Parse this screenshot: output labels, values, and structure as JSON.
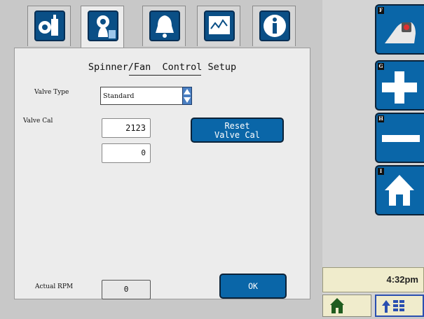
{
  "tabs": [
    {
      "name": "machine-settings-icon"
    },
    {
      "name": "spinner-fan-settings-icon"
    },
    {
      "name": "alarm-bell-icon"
    },
    {
      "name": "performance-monitor-icon"
    },
    {
      "name": "info-icon"
    }
  ],
  "page": {
    "title": "Spinner/Fan  Control Setup",
    "valve_type_label": "Valve Type",
    "valve_type_value": "Standard",
    "valve_cal_label": "Valve Cal",
    "valve_cal_value": "2123",
    "valve_cal_secondary": "0",
    "reset_label": "Reset\nValve Cal",
    "actual_rpm_label": "Actual RPM",
    "actual_rpm_value": "0",
    "ok_label": "OK"
  },
  "side_buttons": [
    {
      "key": "F",
      "icon": "camera-icon"
    },
    {
      "key": "G",
      "icon": "plus-icon"
    },
    {
      "key": "H",
      "icon": "minus-icon"
    },
    {
      "key": "I",
      "icon": "home-icon"
    }
  ],
  "status": {
    "time": "4:32pm"
  },
  "colors": {
    "accent": "#0a66a8",
    "panel": "#ececec",
    "clock_bg": "#f0eccc"
  }
}
